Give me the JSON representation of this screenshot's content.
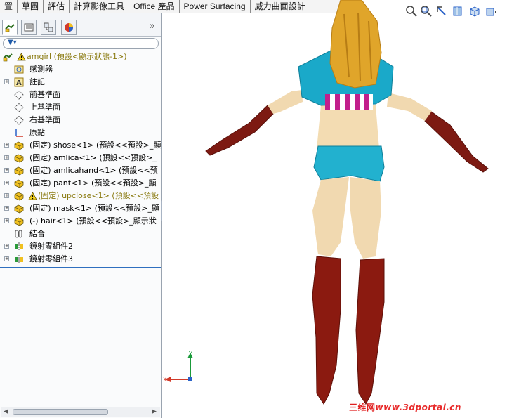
{
  "command_tabs": [
    "置",
    "草圖",
    "評估",
    "計算影像工具",
    "Office 產品",
    "Power Surfacing",
    "威力曲面設計"
  ],
  "panel": {
    "collapse_symbol": "»",
    "tree": [
      {
        "label": "amgirl (預設<顯示狀態-1>)",
        "kind": "root",
        "icon": "assembly-icon",
        "warning": true
      },
      {
        "label": "感測器",
        "kind": "folder",
        "icon": "sensor-icon"
      },
      {
        "label": "註記",
        "kind": "folder",
        "icon": "annotations-icon",
        "expandable": true
      },
      {
        "label": "前基準面",
        "kind": "plane",
        "icon": "plane-icon"
      },
      {
        "label": "上基準面",
        "kind": "plane",
        "icon": "plane-icon"
      },
      {
        "label": "右基準面",
        "kind": "plane",
        "icon": "plane-icon"
      },
      {
        "label": "原點",
        "kind": "origin",
        "icon": "origin-icon"
      },
      {
        "label": "(固定) shose<1> (預設<<預設>_顯",
        "kind": "part",
        "icon": "part-icon",
        "expandable": true
      },
      {
        "label": "(固定) amlica<1> (預設<<預設>_",
        "kind": "part",
        "icon": "part-icon",
        "expandable": true
      },
      {
        "label": "(固定) amlicahand<1> (預設<<預",
        "kind": "part",
        "icon": "part-icon",
        "expandable": true
      },
      {
        "label": "(固定) pant<1> (預設<<預設>_顯",
        "kind": "part",
        "icon": "part-icon",
        "expandable": true
      },
      {
        "label": "(固定) upclose<1> (預設<<預設",
        "kind": "part",
        "icon": "part-icon",
        "expandable": true,
        "warning": true
      },
      {
        "label": "(固定) mask<1> (預設<<預設>_顯",
        "kind": "part",
        "icon": "part-icon",
        "expandable": true
      },
      {
        "label": "(-) hair<1> (預設<<預設>_顯示狀",
        "kind": "part",
        "icon": "part-icon",
        "expandable": true
      },
      {
        "label": "結合",
        "kind": "mates",
        "icon": "mates-icon"
      },
      {
        "label": "鏡射零組件2",
        "kind": "mirror",
        "icon": "mirror-component-icon",
        "expandable": true
      },
      {
        "label": "鏡射零組件3",
        "kind": "mirror",
        "icon": "mirror-component-icon",
        "expandable": true
      }
    ]
  },
  "viewport": {
    "triad_labels": {
      "x": "X",
      "y": "Y"
    },
    "watermark_cn": "三维网",
    "watermark_url": "www.3dportal.cn"
  },
  "colors": {
    "selection_blue": "#2f6fbf",
    "warning_yellow": "#f3d21c",
    "skin": "#f3dcb2",
    "costume_cyan": "#1aa9c9",
    "boots_red": "#8b1a10",
    "hair_gold": "#e0a52a",
    "stripe_magenta": "#c21f8c"
  }
}
